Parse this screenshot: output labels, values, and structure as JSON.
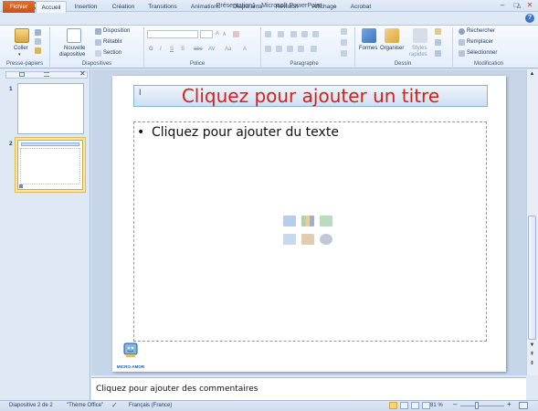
{
  "window": {
    "title": "Présentation1 - Microsoft PowerPoint",
    "app_icon": "P",
    "qat": [
      "save-icon",
      "undo-icon",
      "redo-icon",
      "customize-icon"
    ],
    "controls": [
      "–",
      "□",
      "✕"
    ],
    "minimize_ribbon": "△",
    "help": "?"
  },
  "tabs": [
    {
      "label": "Fichier",
      "active": false
    },
    {
      "label": "Accueil",
      "active": true
    },
    {
      "label": "Insertion"
    },
    {
      "label": "Création"
    },
    {
      "label": "Transitions"
    },
    {
      "label": "Animations"
    },
    {
      "label": "Diaporama"
    },
    {
      "label": "Révision"
    },
    {
      "label": "Affichage"
    },
    {
      "label": "Acrobat"
    }
  ],
  "ribbon": {
    "clipboard": {
      "label": "Presse-papiers",
      "paste": "Coller"
    },
    "slides": {
      "label": "Diapositives",
      "new_slide_1": "Nouvelle",
      "new_slide_2": "diapositive",
      "layout": "Disposition",
      "reset": "Rétablir",
      "section": "Section"
    },
    "font": {
      "label": "Police",
      "bold": "G",
      "italic": "I",
      "underline": "S",
      "strike": "S",
      "shadow": "abc",
      "spacing": "AV",
      "case": "Aa",
      "grow": "A",
      "shrink": "A",
      "color": "A"
    },
    "paragraph": {
      "label": "Paragraphe"
    },
    "drawing": {
      "label": "Dessin",
      "shapes": "Formes",
      "arrange": "Organiser",
      "quick_styles_1": "Styles",
      "quick_styles_2": "rapides"
    },
    "editing": {
      "label": "Modification",
      "find": "Rechercher",
      "replace": "Remplacer",
      "select": "Sélectionner"
    }
  },
  "slides_pane": {
    "slides": [
      {
        "number": "1"
      },
      {
        "number": "2",
        "selected": true
      }
    ]
  },
  "slide": {
    "title_placeholder": "Cliquez pour ajouter un titre",
    "bullet": "•",
    "content_placeholder": "Cliquez pour ajouter du texte",
    "logo_text": "MICRO-AMOR"
  },
  "notes": {
    "placeholder": "Cliquez pour ajouter des commentaires"
  },
  "status": {
    "slide_info": "Diapositive 2 de 2",
    "theme": "\"Thème Office\"",
    "language": "Français (France)",
    "zoom": "81 %",
    "zoom_out": "–",
    "zoom_in": "+"
  },
  "colors": {
    "accent": "#d24726",
    "title_red": "#d4211c",
    "ribbon_blue": "#dfe9f5",
    "selected_slide": "#fbe6a2"
  }
}
